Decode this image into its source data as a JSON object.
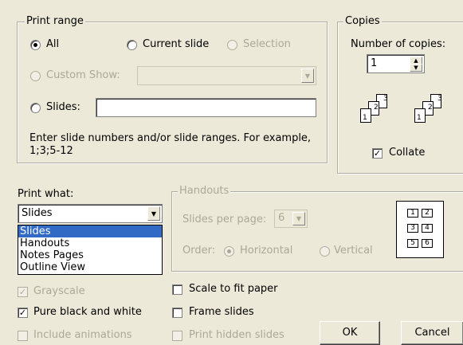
{
  "print_range": {
    "legend": "Print range",
    "all_label": "All",
    "current_slide_label": "Current slide",
    "selection_label": "Selection",
    "custom_show_label": "Custom Show:",
    "slides_label": "Slides:",
    "slides_value": "",
    "hint": "Enter slide numbers and/or slide ranges. For example,",
    "hint_example": "1;3;5-12"
  },
  "copies": {
    "legend": "Copies",
    "number_label": "Number of copies:",
    "number_value": "1",
    "collate_label": "Collate",
    "collate_checked": true
  },
  "print_what": {
    "label": "Print what:",
    "selected": "Slides",
    "options": [
      "Slides",
      "Handouts",
      "Notes Pages",
      "Outline View"
    ]
  },
  "handouts": {
    "legend": "Handouts",
    "slides_per_page_label": "Slides per page:",
    "slides_per_page_value": "6",
    "order_label": "Order:",
    "horizontal_label": "Horizontal",
    "vertical_label": "Vertical",
    "preview_numbers": [
      "1",
      "2",
      "3",
      "4",
      "5",
      "6"
    ]
  },
  "options": {
    "grayscale_label": "Grayscale",
    "pure_bw_label": "Pure black and white",
    "include_animations_label": "Include animations",
    "scale_to_fit_label": "Scale to fit paper",
    "frame_slides_label": "Frame slides",
    "print_hidden_label": "Print hidden slides"
  },
  "buttons": {
    "ok_label": "OK",
    "cancel_label": "Cancel"
  }
}
